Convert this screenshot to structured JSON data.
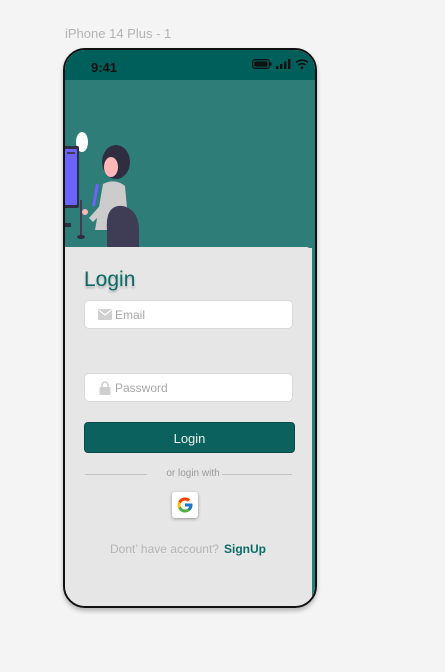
{
  "frame_label": "iPhone 14 Plus - 1",
  "status_bar": {
    "time": "9:41"
  },
  "login": {
    "title": "Login",
    "email_placeholder": "Email",
    "password_placeholder": "Password",
    "login_button": "Login",
    "divider_text": "or login with",
    "signup_prompt": "Dont’ have account?",
    "signup_link": "SignUp"
  },
  "colors": {
    "primary": "#0b615d",
    "hero_background": "#2e7d78",
    "status_bar": "#005f5b",
    "card_background": "#e6e6e6"
  },
  "icons": [
    "battery-icon",
    "signal-icon",
    "wifi-icon",
    "mail-icon",
    "lock-icon",
    "google-icon"
  ]
}
